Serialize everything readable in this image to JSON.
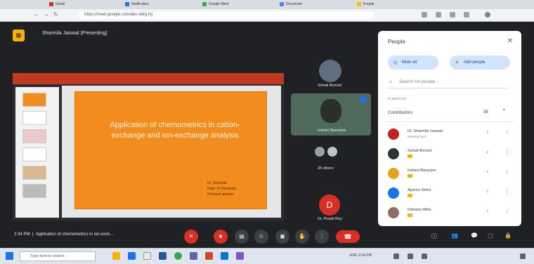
{
  "browser": {
    "tabs": [
      "Gmail",
      "Notification",
      "Google Meet",
      "Document",
      "People"
    ],
    "url": "https://meet.google.com/abc-defg-hij"
  },
  "meet": {
    "presenting_label": "Sharmila Jaiswal (Presenting)",
    "slide": {
      "title": "Application of chemometrics in cation-exchange and ion-exchange analysis",
      "author_lines": [
        "Dr. Sharmila",
        "Dept. of Chemistry",
        "Principal speaker"
      ]
    },
    "tiles": {
      "t1_name": "Sohail Ahmed",
      "t2_name": "Indrani Banerjee",
      "t3_name": "34 others",
      "t4_name": "Dr. Pinaki Roy",
      "t4_initial": "D"
    },
    "info": {
      "time": "2:34 PM",
      "title": "Application of chemometrics in ion-exch..."
    }
  },
  "people": {
    "title": "People",
    "close": "✕",
    "mute_all": "Mute all",
    "add_people": "Add people",
    "search_placeholder": "Search for people",
    "section_label": "IN MEETING",
    "contributors_label": "Contributors",
    "contributors_count": "36",
    "participants": [
      {
        "name": "Dr. Sharmila Jaiswal",
        "sub": "Meeting host",
        "color": "#c5221f"
      },
      {
        "name": "Sohail Ahmed",
        "sub": "",
        "color": "#2f3438"
      },
      {
        "name": "Indrani Banerjee",
        "sub": "",
        "color": "#e8a317"
      },
      {
        "name": "Aparna Sinha",
        "sub": "",
        "color": "#1a73e8"
      },
      {
        "name": "Debasis Mitra",
        "sub": "",
        "color": "#8d6e63"
      }
    ]
  },
  "taskbar": {
    "search_placeholder": "Type here to search",
    "tray": "ENG 2:34 PM"
  },
  "colors": {
    "meet_bg": "#202124",
    "slide_orange": "#f28c1c",
    "end_call_red": "#d93025"
  }
}
